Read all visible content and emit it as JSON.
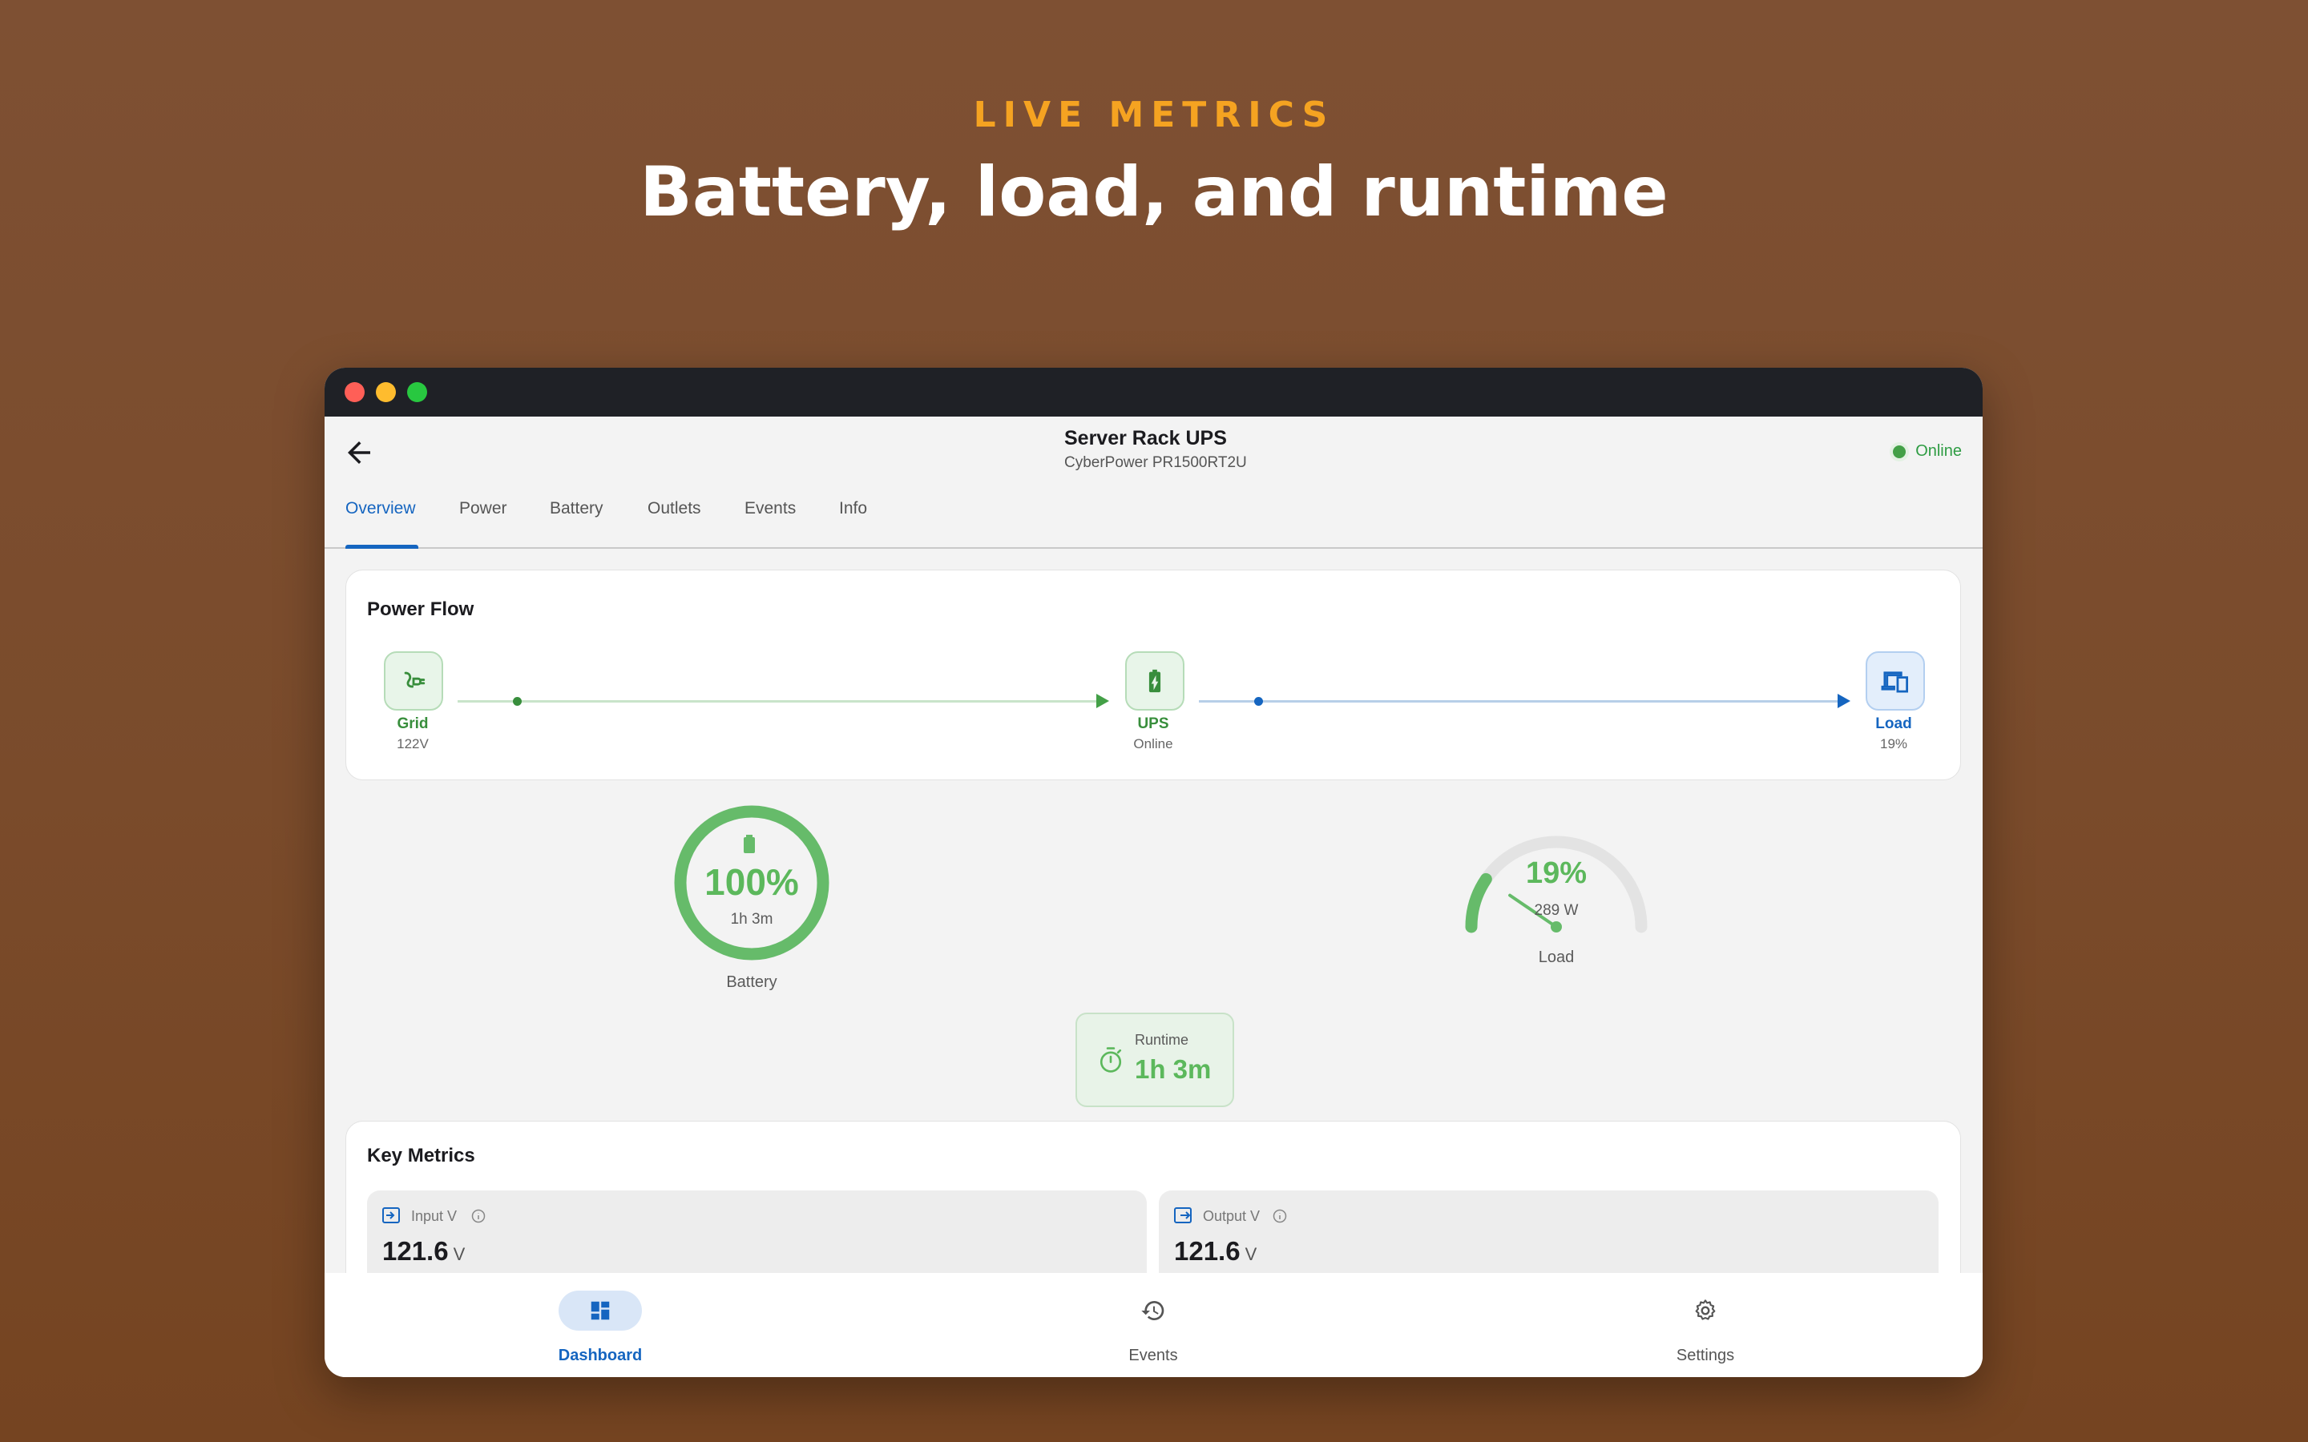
{
  "hero": {
    "eyebrow": "LIVE METRICS",
    "headline": "Battery, load, and runtime"
  },
  "header": {
    "title": "Server Rack UPS",
    "subtitle": "CyberPower PR1500RT2U",
    "status": "Online"
  },
  "tabs": [
    {
      "label": "Overview",
      "active": true
    },
    {
      "label": "Power"
    },
    {
      "label": "Battery"
    },
    {
      "label": "Outlets"
    },
    {
      "label": "Events"
    },
    {
      "label": "Info"
    }
  ],
  "power_flow": {
    "title": "Power Flow",
    "nodes": [
      {
        "label": "Grid",
        "value": "122V",
        "icon": "plug-icon"
      },
      {
        "label": "UPS",
        "value": "Online",
        "icon": "battery-charging-icon"
      },
      {
        "label": "Load",
        "value": "19%",
        "icon": "devices-icon"
      }
    ]
  },
  "battery": {
    "percent_text": "100%",
    "percent": 100,
    "runtime": "1h 3m",
    "label": "Battery"
  },
  "load": {
    "percent_text": "19%",
    "percent": 19,
    "watts": "289 W",
    "label": "Load"
  },
  "runtime": {
    "label": "Runtime",
    "value": "1h 3m"
  },
  "key_metrics": {
    "title": "Key Metrics",
    "items": [
      {
        "label": "Input V",
        "value": "121.6",
        "unit": "V",
        "icon": "input-icon"
      },
      {
        "label": "Output V",
        "value": "121.6",
        "unit": "V",
        "icon": "output-icon"
      }
    ]
  },
  "nav": [
    {
      "label": "Dashboard",
      "icon": "dashboard-icon",
      "active": true
    },
    {
      "label": "Events",
      "icon": "history-icon"
    },
    {
      "label": "Settings",
      "icon": "gear-icon"
    }
  ],
  "colors": {
    "accent_blue": "#1565c0",
    "success_green": "#43a047",
    "eyebrow_orange": "#f5a321"
  }
}
